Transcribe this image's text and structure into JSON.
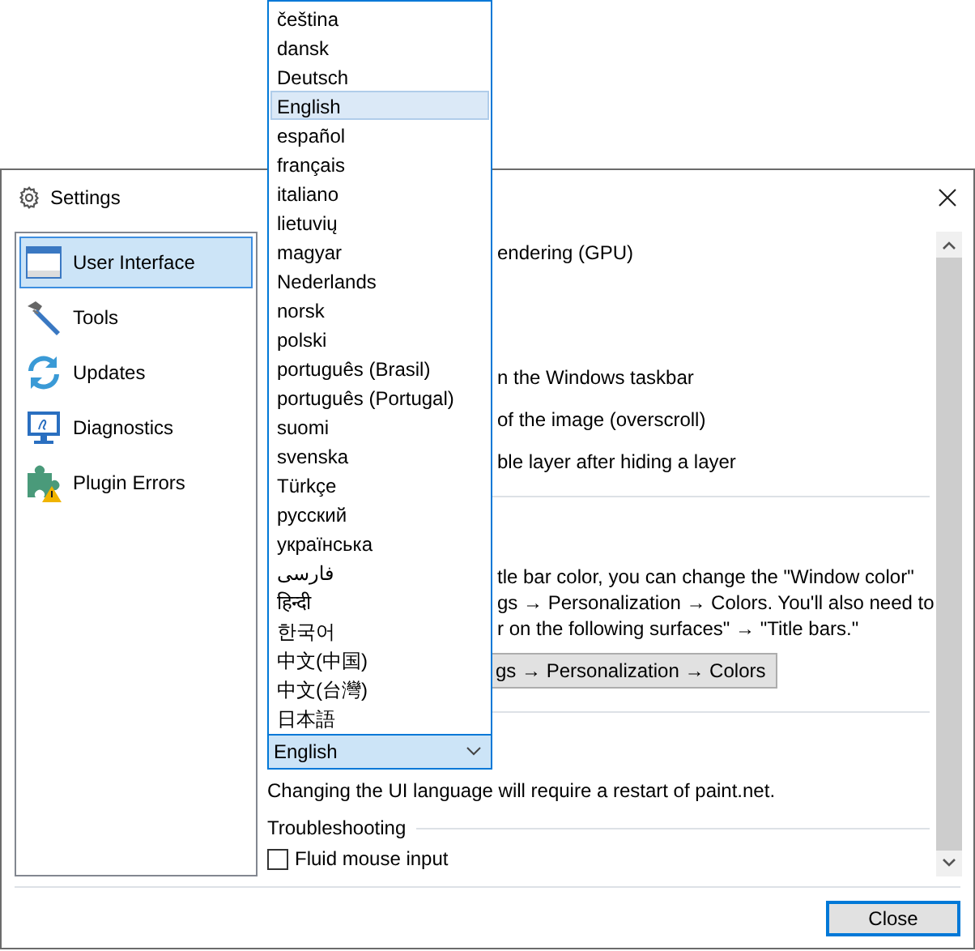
{
  "window": {
    "title": "Settings"
  },
  "sidebar": {
    "items": [
      {
        "label": "User Interface",
        "selected": true
      },
      {
        "label": "Tools",
        "selected": false
      },
      {
        "label": "Updates",
        "selected": false
      },
      {
        "label": "Diagnostics",
        "selected": false
      },
      {
        "label": "Plugin Errors",
        "selected": false
      }
    ]
  },
  "content": {
    "option_lines": [
      "endering (GPU)",
      "n the Windows taskbar",
      "of the image (overscroll)",
      "ble layer after hiding a layer"
    ],
    "paragraph_lines": [
      "tle bar color, you can change the \"Window color\"",
      "gs → Personalization → Colors. You'll also need to",
      "r on the following surfaces\" → \"Title bars.\""
    ],
    "settings_button": "gs → Personalization → Colors",
    "language_combo": {
      "value": "English",
      "expanded": true
    },
    "language_note": "Changing the UI language will require a restart of paint.net.",
    "troubleshooting": {
      "heading": "Troubleshooting",
      "checkboxes": [
        {
          "label": "Fluid mouse input",
          "checked": false
        }
      ]
    }
  },
  "dropdown": {
    "items": [
      {
        "label": "čeština",
        "selected": false
      },
      {
        "label": "dansk",
        "selected": false
      },
      {
        "label": "Deutsch",
        "selected": false
      },
      {
        "label": "English",
        "selected": true
      },
      {
        "label": "español",
        "selected": false
      },
      {
        "label": "français",
        "selected": false
      },
      {
        "label": "italiano",
        "selected": false
      },
      {
        "label": "lietuvių",
        "selected": false
      },
      {
        "label": "magyar",
        "selected": false
      },
      {
        "label": "Nederlands",
        "selected": false
      },
      {
        "label": "norsk",
        "selected": false
      },
      {
        "label": "polski",
        "selected": false
      },
      {
        "label": "português (Brasil)",
        "selected": false
      },
      {
        "label": "português (Portugal)",
        "selected": false
      },
      {
        "label": "suomi",
        "selected": false
      },
      {
        "label": "svenska",
        "selected": false
      },
      {
        "label": "Türkçe",
        "selected": false
      },
      {
        "label": "русский",
        "selected": false
      },
      {
        "label": "українська",
        "selected": false
      },
      {
        "label": "فارسی",
        "selected": false
      },
      {
        "label": "हिन्दी",
        "selected": false
      },
      {
        "label": "한국어",
        "selected": false
      },
      {
        "label": "中文(中国)",
        "selected": false
      },
      {
        "label": "中文(台灣)",
        "selected": false
      },
      {
        "label": "日本語",
        "selected": false
      }
    ]
  },
  "buttons": [
    "Close"
  ]
}
